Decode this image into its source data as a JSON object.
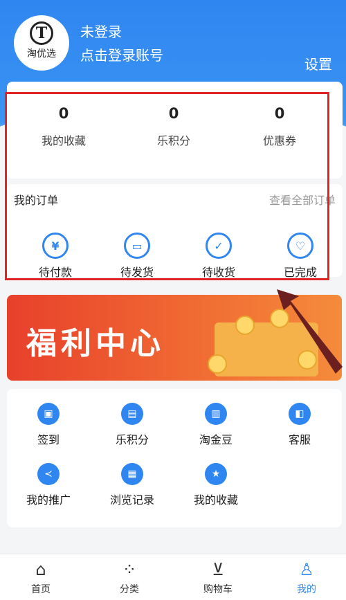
{
  "colors": {
    "accent": "#2f86f0",
    "highlight": "#e02424",
    "banner": "#e8402b"
  },
  "profile": {
    "avatar_logo_char": "T",
    "avatar_logo_text": "淘优选",
    "title": "未登录",
    "subtitle": "点击登录账号",
    "settings_label": "设置"
  },
  "stats": [
    {
      "value": "0",
      "label": "我的收藏"
    },
    {
      "value": "0",
      "label": "乐积分"
    },
    {
      "value": "0",
      "label": "优惠券"
    }
  ],
  "orders": {
    "title": "我的订单",
    "view_all": "查看全部订单",
    "items": [
      {
        "label": "待付款",
        "icon": "yen-icon",
        "glyph": "¥"
      },
      {
        "label": "待发货",
        "icon": "package-icon",
        "glyph": "▭"
      },
      {
        "label": "待收货",
        "icon": "receipt-icon",
        "glyph": "✓"
      },
      {
        "label": "已完成",
        "icon": "heart-icon",
        "glyph": "♡"
      }
    ]
  },
  "banner": {
    "text": "福利中心"
  },
  "tools": [
    {
      "label": "签到",
      "icon": "calendar-icon",
      "glyph": "▣"
    },
    {
      "label": "乐积分",
      "icon": "points-icon",
      "glyph": "▤"
    },
    {
      "label": "淘金豆",
      "icon": "bean-icon",
      "glyph": "▥"
    },
    {
      "label": "客服",
      "icon": "service-icon",
      "glyph": "◧"
    },
    {
      "label": "我的推广",
      "icon": "share-icon",
      "glyph": "≺"
    },
    {
      "label": "浏览记录",
      "icon": "history-icon",
      "glyph": "▦"
    },
    {
      "label": "我的收藏",
      "icon": "star-icon",
      "glyph": "★"
    }
  ],
  "tabbar": [
    {
      "label": "首页",
      "icon": "home-icon",
      "glyph": "⌂"
    },
    {
      "label": "分类",
      "icon": "category-icon",
      "glyph": "⁘"
    },
    {
      "label": "购物车",
      "icon": "cart-icon",
      "glyph": "⊻"
    },
    {
      "label": "我的",
      "icon": "user-icon",
      "glyph": "♙"
    }
  ]
}
